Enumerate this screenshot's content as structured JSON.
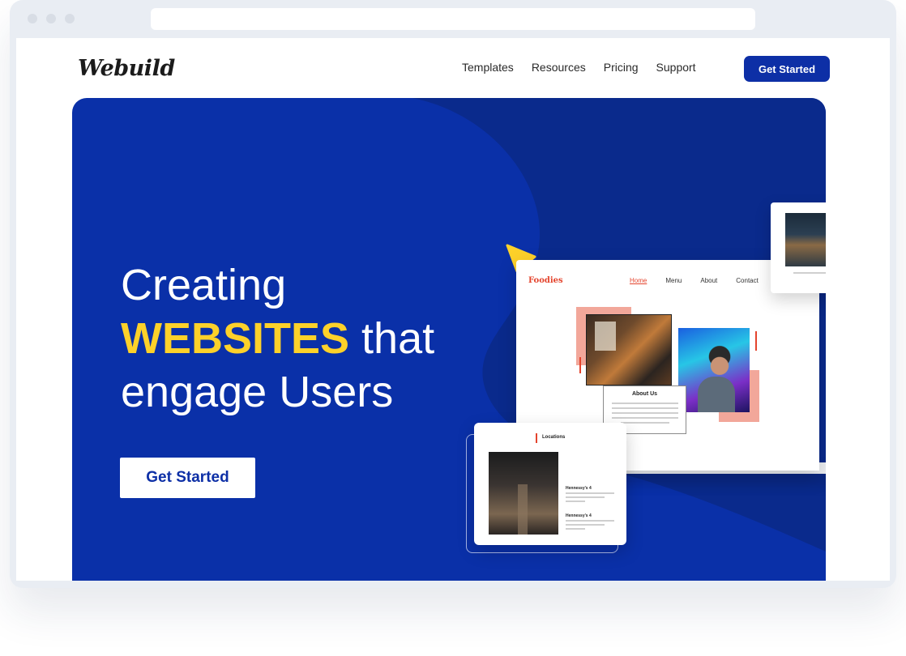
{
  "brand": {
    "name": "Webuild"
  },
  "nav": {
    "items": [
      {
        "label": "Templates"
      },
      {
        "label": "Resources"
      },
      {
        "label": "Pricing"
      },
      {
        "label": "Support"
      }
    ],
    "cta_label": "Get Started"
  },
  "hero": {
    "line1": "Creating",
    "highlight": "WEBSITES",
    "line2_rest": " that",
    "line3": "engage Users",
    "cta_label": "Get Started",
    "colors": {
      "background": "#0a30a8",
      "highlight": "#fdd12a",
      "accent_blob": "#0a2a8c"
    }
  },
  "mockup": {
    "site_name": "Foodies",
    "nav": [
      "Home",
      "Menu",
      "About",
      "Contact"
    ],
    "about_title": "About Us",
    "locations_title": "Locations",
    "location_names": [
      "Hennessy's 4",
      "Hennessy's 4"
    ]
  },
  "colors": {
    "primary": "#0d2fa6",
    "accent_red": "#e4442d",
    "accent_pink": "#f2a79a"
  }
}
